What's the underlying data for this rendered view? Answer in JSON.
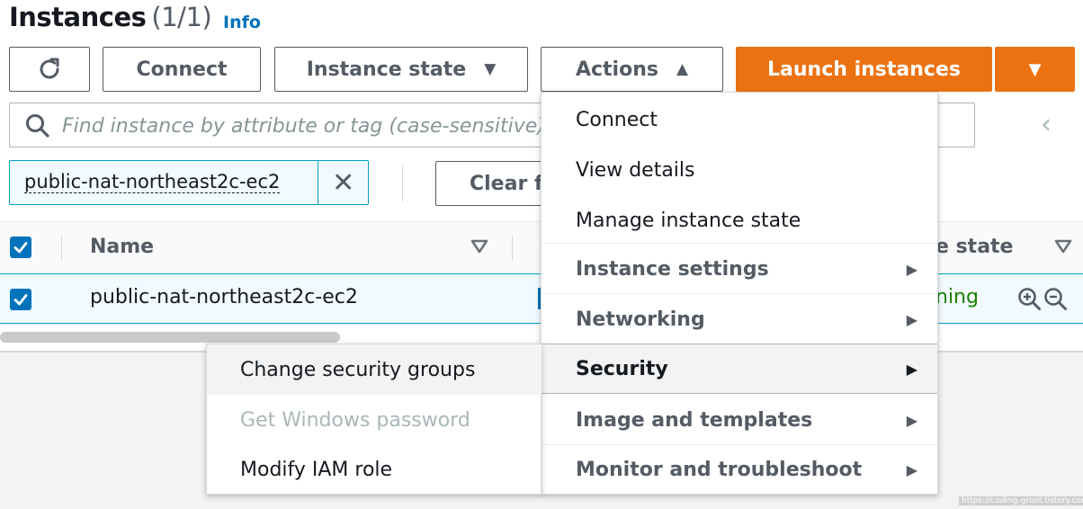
{
  "header": {
    "title": "Instances",
    "count": "(1/1)",
    "info_link": "Info"
  },
  "toolbar": {
    "refresh_icon": "refresh-icon",
    "connect_label": "Connect",
    "instance_state_label": "Instance state",
    "actions_label": "Actions",
    "launch_label": "Launch instances",
    "accent_color": "#ec7211"
  },
  "search": {
    "placeholder": "Find instance by attribute or tag (case-sensitive)"
  },
  "filter": {
    "token": "public-nat-northeast2c-ec2",
    "clear_label": "Clear filters"
  },
  "table": {
    "columns": [
      "Name",
      "Instance state"
    ],
    "column_state_visible": "e state",
    "rows": [
      {
        "name": "public-nat-northeast2c-ec2",
        "state_visible": "ning",
        "state_color": "#1d8102"
      }
    ]
  },
  "actions_menu": {
    "items": [
      {
        "label": "Connect"
      },
      {
        "label": "View details"
      },
      {
        "label": "Manage instance state"
      },
      {
        "label": "Instance settings"
      },
      {
        "label": "Networking"
      },
      {
        "label": "Security"
      },
      {
        "label": "Image and templates"
      },
      {
        "label": "Monitor and troubleshoot"
      }
    ]
  },
  "security_submenu": {
    "items": [
      {
        "label": "Change security groups"
      },
      {
        "label": "Get Windows password"
      },
      {
        "label": "Modify IAM role"
      }
    ]
  },
  "watermark": "https://coding-groot.tistory.com"
}
